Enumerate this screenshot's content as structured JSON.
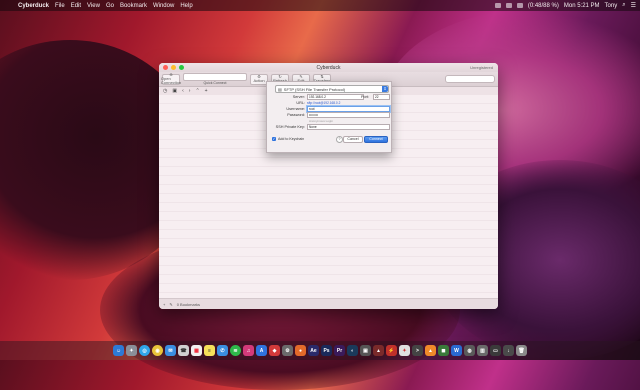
{
  "menubar": {
    "app": "Cyberduck",
    "menus": [
      "File",
      "Edit",
      "View",
      "Go",
      "Bookmark",
      "Window",
      "Help"
    ],
    "battery": "(0:48/88 %)",
    "clock": "Mon 5:21 PM",
    "user": "Tony"
  },
  "window": {
    "title": "Cyberduck",
    "unregistered": "Unregistered",
    "toolbar": {
      "open_connection": "Open Connection",
      "quick_connect": "Quick Connect",
      "action": "Action",
      "refresh": "Refresh",
      "edit": "Edit",
      "transfers": "Transfers"
    },
    "status": "0 Bookmarks"
  },
  "sheet": {
    "protocol": "SFTP (SSH File Transfer Protocol)",
    "server_label": "Server:",
    "server": "192.168.0.2",
    "port_label": "Port:",
    "port": "22",
    "url_label": "URL:",
    "url": "sftp://root@192.168.0.2",
    "username_label": "Username:",
    "username": "root",
    "password_label": "Password:",
    "password": "••••••••",
    "anonymous": "Anonymous Login",
    "key_label": "SSH Private Key:",
    "key": "None",
    "keychain": "Add to Keychain",
    "help": "?",
    "cancel": "Cancel",
    "connect": "Connect"
  },
  "colors": {
    "accent": "#2f73de",
    "close": "#ff5f57",
    "minimize": "#ffbd2e",
    "zoom": "#28c940"
  }
}
